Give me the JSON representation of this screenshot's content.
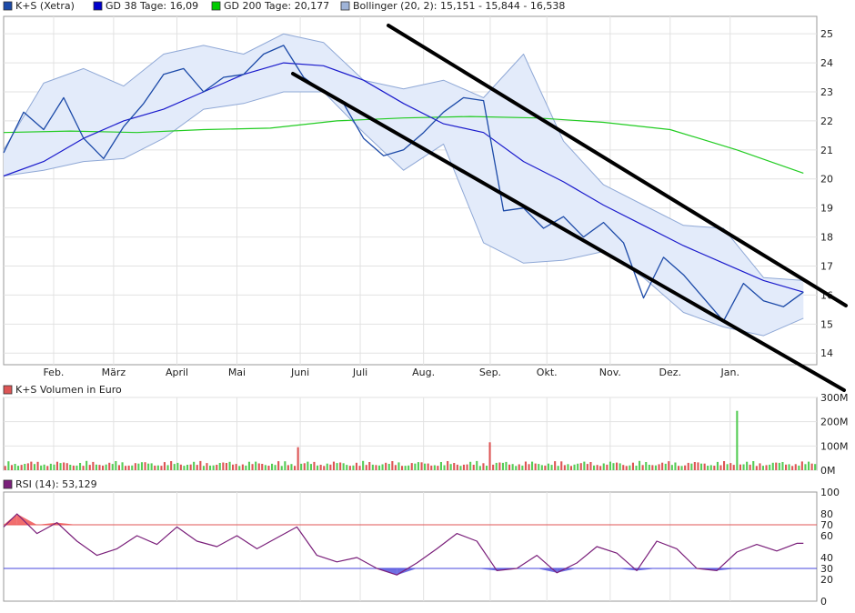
{
  "chart_data": [
    {
      "type": "line",
      "panel": "price",
      "legend": [
        {
          "label": "K+S (Xetra)",
          "color": "#1c4aa8"
        },
        {
          "label": "GD 38 Tage: 16,09",
          "color": "#0000cc"
        },
        {
          "label": "GD 200 Tage: 20,177",
          "color": "#00cc00"
        },
        {
          "label": "Bollinger (20, 2): 15,151 - 15,844 - 16,538",
          "color": "#9fb4d8"
        }
      ],
      "x_tick_labels": [
        "Feb.",
        "März",
        "April",
        "Mai",
        "Juni",
        "Juli",
        "Aug.",
        "Sep.",
        "Okt.",
        "Nov.",
        "Dez.",
        "Jan."
      ],
      "y_tick_labels": [
        "14",
        "15",
        "16",
        "17",
        "18",
        "19",
        "20",
        "21",
        "22",
        "23",
        "24",
        "25"
      ],
      "ylim": [
        13.6,
        25.6
      ],
      "x_range": [
        0,
        12.2
      ],
      "series": [
        {
          "role": "price",
          "x": [
            0,
            0.3,
            0.6,
            0.9,
            1.2,
            1.5,
            1.8,
            2.1,
            2.4,
            2.7,
            3.0,
            3.3,
            3.6,
            3.9,
            4.2,
            4.5,
            4.8,
            5.1,
            5.4,
            5.7,
            6.0,
            6.3,
            6.6,
            6.9,
            7.2,
            7.5,
            7.8,
            8.1,
            8.4,
            8.7,
            9.0,
            9.3,
            9.6,
            9.9,
            10.2,
            10.5,
            10.8,
            11.1,
            11.4,
            11.7,
            12.0
          ],
          "values": [
            20.9,
            22.3,
            21.7,
            22.8,
            21.4,
            20.7,
            21.8,
            22.6,
            23.6,
            23.8,
            23.0,
            23.5,
            23.6,
            24.3,
            24.6,
            23.5,
            23.0,
            22.6,
            21.4,
            20.8,
            21.0,
            21.6,
            22.3,
            22.8,
            22.7,
            18.9,
            19.0,
            18.3,
            18.7,
            18.0,
            18.5,
            17.8,
            15.9,
            17.3,
            16.7,
            15.9,
            15.1,
            16.4,
            15.8,
            15.6,
            16.1
          ]
        },
        {
          "role": "gd38",
          "x": [
            0,
            0.6,
            1.2,
            1.8,
            2.4,
            3.0,
            3.6,
            4.2,
            4.8,
            5.4,
            6.0,
            6.6,
            7.2,
            7.8,
            8.4,
            9.0,
            9.6,
            10.2,
            10.8,
            11.4,
            12.0
          ],
          "values": [
            20.1,
            20.6,
            21.4,
            22.0,
            22.4,
            23.0,
            23.6,
            24.0,
            23.9,
            23.4,
            22.6,
            21.9,
            21.6,
            20.6,
            19.9,
            19.1,
            18.4,
            17.7,
            17.1,
            16.5,
            16.1
          ]
        },
        {
          "role": "gd200",
          "x": [
            0,
            1.0,
            2.0,
            3.0,
            4.0,
            5.0,
            6.0,
            7.0,
            8.0,
            9.0,
            10.0,
            11.0,
            12.0
          ],
          "values": [
            21.6,
            21.65,
            21.6,
            21.7,
            21.75,
            22.0,
            22.1,
            22.15,
            22.1,
            21.95,
            21.7,
            21.0,
            20.2
          ]
        },
        {
          "role": "bollinger_upper",
          "x": [
            0,
            0.6,
            1.2,
            1.8,
            2.4,
            3.0,
            3.6,
            4.2,
            4.8,
            5.4,
            6.0,
            6.6,
            7.2,
            7.8,
            8.4,
            9.0,
            9.6,
            10.2,
            10.8,
            11.4,
            12.0
          ],
          "values": [
            21.0,
            23.3,
            23.8,
            23.2,
            24.3,
            24.6,
            24.3,
            25.0,
            24.7,
            23.4,
            23.1,
            23.4,
            22.8,
            24.3,
            21.3,
            19.8,
            19.1,
            18.4,
            18.3,
            16.6,
            16.5
          ]
        },
        {
          "role": "bollinger_lower",
          "x": [
            0,
            0.6,
            1.2,
            1.8,
            2.4,
            3.0,
            3.6,
            4.2,
            4.8,
            5.4,
            6.0,
            6.6,
            7.2,
            7.8,
            8.4,
            9.0,
            9.6,
            10.2,
            10.8,
            11.4,
            12.0
          ],
          "values": [
            20.1,
            20.3,
            20.6,
            20.7,
            21.4,
            22.4,
            22.6,
            23.0,
            23.0,
            21.6,
            20.3,
            21.2,
            17.8,
            17.1,
            17.2,
            17.5,
            16.6,
            15.4,
            14.9,
            14.6,
            15.2
          ]
        }
      ]
    },
    {
      "type": "bar",
      "panel": "volume",
      "title": "K+S Volumen in Euro",
      "y_tick_labels": [
        "0M",
        "100M",
        "200M",
        "300M"
      ],
      "ylim": [
        0,
        300
      ],
      "notable_bars": [
        {
          "x": 7.3,
          "value": 115
        },
        {
          "x": 11.0,
          "value": 245
        },
        {
          "x": 4.4,
          "value": 95
        }
      ],
      "typical_value": 35
    },
    {
      "type": "line",
      "panel": "rsi",
      "title": "RSI (14): 53,129",
      "y_tick_labels": [
        "0",
        "20",
        "30",
        "40",
        "60",
        "70",
        "80",
        "100"
      ],
      "ylim": [
        0,
        100
      ],
      "reference_lines": [
        70,
        30
      ],
      "series": [
        {
          "role": "rsi",
          "x": [
            0,
            0.2,
            0.5,
            0.8,
            1.1,
            1.4,
            1.7,
            2.0,
            2.3,
            2.6,
            2.9,
            3.2,
            3.5,
            3.8,
            4.1,
            4.4,
            4.7,
            5.0,
            5.3,
            5.6,
            5.9,
            6.2,
            6.5,
            6.8,
            7.1,
            7.4,
            7.7,
            8.0,
            8.3,
            8.6,
            8.9,
            9.2,
            9.5,
            9.8,
            10.1,
            10.4,
            10.7,
            11.0,
            11.3,
            11.6,
            11.9,
            12.0
          ],
          "values": [
            68,
            80,
            62,
            72,
            55,
            42,
            48,
            60,
            52,
            68,
            55,
            50,
            60,
            48,
            58,
            68,
            42,
            36,
            40,
            30,
            24,
            35,
            48,
            62,
            55,
            28,
            30,
            42,
            26,
            35,
            50,
            44,
            28,
            55,
            48,
            30,
            28,
            45,
            52,
            46,
            53,
            53
          ]
        }
      ]
    }
  ]
}
